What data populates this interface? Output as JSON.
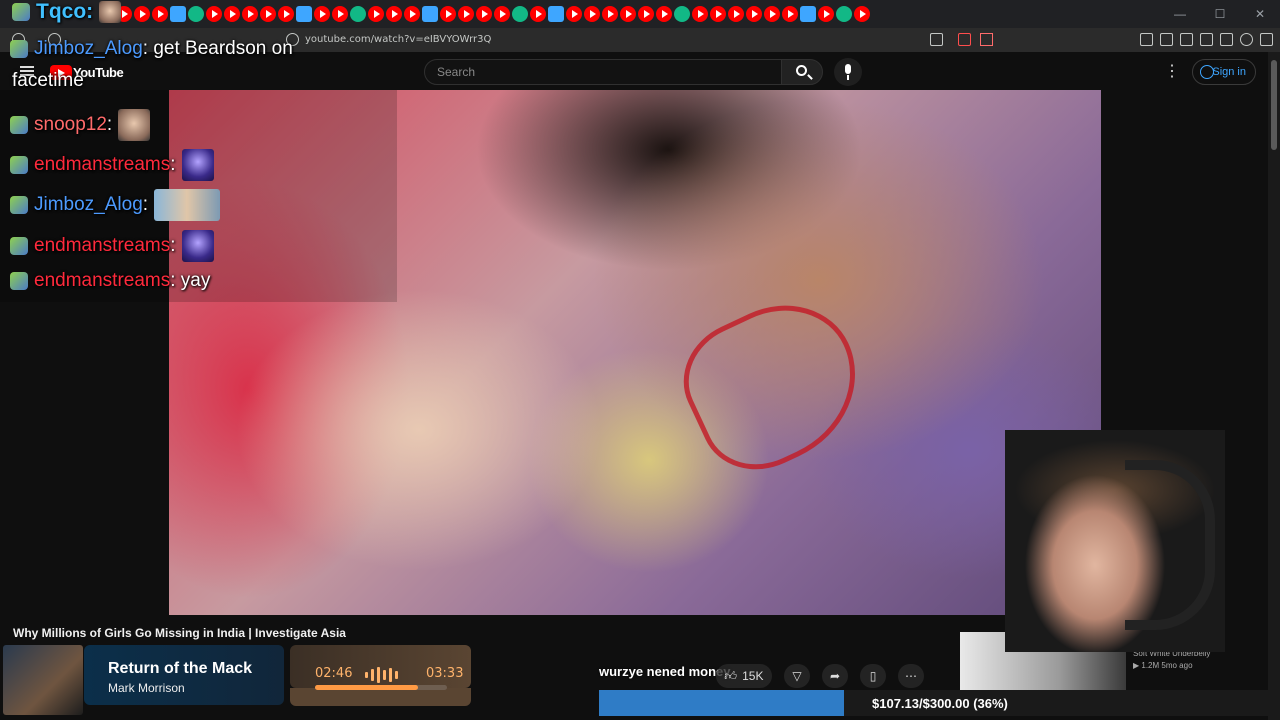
{
  "browser": {
    "url": "youtube.com/watch?v=eIBVYOWrr3Q"
  },
  "youtube": {
    "logo_text": "YouTube",
    "search_placeholder": "Search",
    "sign_in_label": "Sign in"
  },
  "chat": {
    "top_user": "Tqco:",
    "messages": [
      {
        "user": "Jimboz_Alog",
        "text": ": get Beardson on",
        "color": "#4d9bff"
      },
      {
        "user": "",
        "text": "facetime",
        "color": "#ffffff"
      },
      {
        "user": "snoop12",
        "text": ":",
        "color": "#ff6b6b",
        "emote": "face"
      },
      {
        "user": "endmanstreams",
        "text": ":",
        "color": "#ff2a3c",
        "emote": "purple"
      },
      {
        "user": "Jimboz_Alog",
        "text": ":",
        "color": "#4d9bff",
        "emote": "wide"
      },
      {
        "user": "endmanstreams",
        "text": ":",
        "color": "#ff2a3c",
        "emote": "purple"
      },
      {
        "user": "endmanstreams",
        "text": ": yay",
        "color": "#ff2a3c"
      }
    ]
  },
  "video": {
    "title": "Why Millions of Girls Go Missing in India | Investigate Asia",
    "likes": "15K"
  },
  "now_playing": {
    "title": "Return of the Mack",
    "artist": "Mark Morrison",
    "current_time": "02:46",
    "total_time": "03:33",
    "progress": 0.78
  },
  "goal": {
    "message": "wurzye nened money",
    "text": "$107.13/$300.00 (36%)",
    "progress": 0.36
  },
  "side_video": {
    "channel": "Soft White Underbelly",
    "meta": "▶ 1.2M  5mo ago"
  }
}
